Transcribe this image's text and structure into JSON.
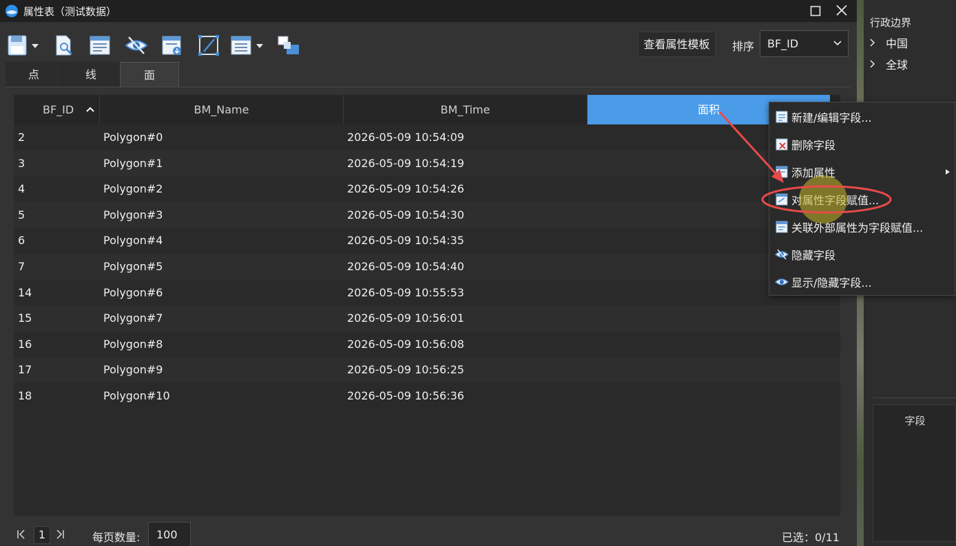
{
  "window": {
    "title": "属性表（测试数据）"
  },
  "toolbar": {
    "icons": [
      "save-icon",
      "search-doc-icon",
      "table-form-icon",
      "hide-eye-icon",
      "export-icon",
      "edit-frame-icon",
      "list-menu-icon",
      "layers-icon"
    ],
    "template_button": "查看属性模板",
    "sort_label": "排序",
    "sort_value": "BF_ID"
  },
  "tabs": [
    {
      "label": "点"
    },
    {
      "label": "线"
    },
    {
      "label": "面"
    }
  ],
  "table": {
    "columns": [
      "BF_ID",
      "BM_Name",
      "BM_Time",
      "面积"
    ],
    "rows": [
      {
        "id": "2",
        "name": "Polygon#0",
        "time": "2026-05-09 10:54:09"
      },
      {
        "id": "3",
        "name": "Polygon#1",
        "time": "2026-05-09 10:54:19"
      },
      {
        "id": "4",
        "name": "Polygon#2",
        "time": "2026-05-09 10:54:26"
      },
      {
        "id": "5",
        "name": "Polygon#3",
        "time": "2026-05-09 10:54:30"
      },
      {
        "id": "6",
        "name": "Polygon#4",
        "time": "2026-05-09 10:54:35"
      },
      {
        "id": "7",
        "name": "Polygon#5",
        "time": "2026-05-09 10:54:40"
      },
      {
        "id": "14",
        "name": "Polygon#6",
        "time": "2026-05-09 10:55:53"
      },
      {
        "id": "15",
        "name": "Polygon#7",
        "time": "2026-05-09 10:56:01"
      },
      {
        "id": "16",
        "name": "Polygon#8",
        "time": "2026-05-09 10:56:08"
      },
      {
        "id": "17",
        "name": "Polygon#9",
        "time": "2026-05-09 10:56:25"
      },
      {
        "id": "18",
        "name": "Polygon#10",
        "time": "2026-05-09 10:56:36"
      }
    ]
  },
  "footer": {
    "page": "1",
    "per_page_label": "每页数量:",
    "per_page_value": "100",
    "selected": "已选：0/11"
  },
  "right_panel": {
    "title": "行政边界",
    "tree": [
      "中国",
      "全球"
    ],
    "field_title": "字段"
  },
  "context_menu": {
    "items": [
      {
        "label": "新建/编辑字段...",
        "icon": "new-field-icon"
      },
      {
        "label": "删除字段",
        "icon": "delete-field-icon"
      },
      {
        "label": "添加属性",
        "icon": "add-attribute-icon"
      },
      {
        "label": "对属性字段赋值...",
        "icon": "assign-value-icon"
      },
      {
        "label": "关联外部属性为字段赋值...",
        "icon": "link-external-icon"
      },
      {
        "label": "隐藏字段",
        "icon": "hide-field-icon"
      },
      {
        "label": "显示/隐藏字段...",
        "icon": "show-hide-field-icon"
      }
    ]
  },
  "colors": {
    "accent": "#4a9be8",
    "annotation": "#e84a4a"
  }
}
